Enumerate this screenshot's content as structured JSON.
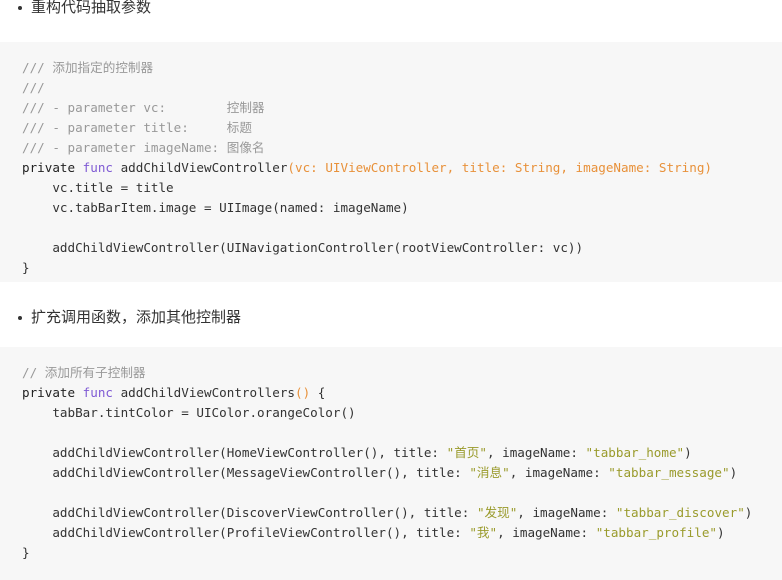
{
  "document": {
    "background_color": "#ffffff",
    "text_color": "#333333",
    "code_background": "#f7f7f7"
  },
  "syntax_colors": {
    "comment": "#999999",
    "keyword": "#7f5ad4",
    "parameter": "#e8913a",
    "string": "#9a9b2c",
    "plain": "#333333"
  },
  "sections": [
    {
      "heading": "重构代码抽取参数",
      "bullet": "•",
      "code": {
        "lines": [
          [
            {
              "t": "/// ",
              "c": "comment"
            },
            {
              "t": "添加指定的控制器",
              "c": "comment"
            }
          ],
          [
            {
              "t": "///",
              "c": "comment"
            }
          ],
          [
            {
              "t": "/// - parameter vc:        ",
              "c": "comment"
            },
            {
              "t": "控制器",
              "c": "comment"
            }
          ],
          [
            {
              "t": "/// - parameter title:     ",
              "c": "comment"
            },
            {
              "t": "标题",
              "c": "comment"
            }
          ],
          [
            {
              "t": "/// - parameter imageName: ",
              "c": "comment"
            },
            {
              "t": "图像名",
              "c": "comment"
            }
          ],
          [
            {
              "t": "private ",
              "c": "strong"
            },
            {
              "t": "func ",
              "c": "keyword"
            },
            {
              "t": "addChildViewController",
              "c": "plain"
            },
            {
              "t": "(vc: UIViewController, title: String, imageName: String)",
              "c": "param"
            }
          ],
          [
            {
              "t": "    vc.title = title",
              "c": "plain"
            }
          ],
          [
            {
              "t": "    vc.tabBarItem.image = UIImage(named: imageName)",
              "c": "plain"
            }
          ],
          [
            {
              "t": "",
              "c": "plain"
            }
          ],
          [
            {
              "t": "    addChildViewController(UINavigationController(rootViewController: vc))",
              "c": "plain"
            }
          ],
          [
            {
              "t": "}",
              "c": "plain"
            }
          ]
        ]
      }
    },
    {
      "heading": "扩充调用函数，添加其他控制器",
      "bullet": "•",
      "code": {
        "lines": [
          [
            {
              "t": "// ",
              "c": "comment"
            },
            {
              "t": "添加所有子控制器",
              "c": "comment"
            }
          ],
          [
            {
              "t": "private ",
              "c": "strong"
            },
            {
              "t": "func ",
              "c": "keyword"
            },
            {
              "t": "addChildViewControllers",
              "c": "plain"
            },
            {
              "t": "()",
              "c": "param"
            },
            {
              "t": " {",
              "c": "plain"
            }
          ],
          [
            {
              "t": "    tabBar.tintColor = UIColor.orangeColor()",
              "c": "plain"
            }
          ],
          [
            {
              "t": "",
              "c": "plain"
            }
          ],
          [
            {
              "t": "    addChildViewController(HomeViewController(), title: ",
              "c": "plain"
            },
            {
              "t": "\"首页\"",
              "c": "string"
            },
            {
              "t": ", imageName: ",
              "c": "plain"
            },
            {
              "t": "\"tabbar_home\"",
              "c": "string"
            },
            {
              "t": ")",
              "c": "plain"
            }
          ],
          [
            {
              "t": "    addChildViewController(MessageViewController(), title: ",
              "c": "plain"
            },
            {
              "t": "\"消息\"",
              "c": "string"
            },
            {
              "t": ", imageName: ",
              "c": "plain"
            },
            {
              "t": "\"tabbar_message\"",
              "c": "string"
            },
            {
              "t": ")",
              "c": "plain"
            }
          ],
          [
            {
              "t": "",
              "c": "plain"
            }
          ],
          [
            {
              "t": "    addChildViewController(DiscoverViewController(), title: ",
              "c": "plain"
            },
            {
              "t": "\"发现\"",
              "c": "string"
            },
            {
              "t": ", imageName: ",
              "c": "plain"
            },
            {
              "t": "\"tabbar_discover\"",
              "c": "string"
            },
            {
              "t": ")",
              "c": "plain"
            }
          ],
          [
            {
              "t": "    addChildViewController(ProfileViewController(), title: ",
              "c": "plain"
            },
            {
              "t": "\"我\"",
              "c": "string"
            },
            {
              "t": ", imageName: ",
              "c": "plain"
            },
            {
              "t": "\"tabbar_profile\"",
              "c": "string"
            },
            {
              "t": ")",
              "c": "plain"
            }
          ],
          [
            {
              "t": "}",
              "c": "plain"
            }
          ]
        ]
      }
    }
  ]
}
